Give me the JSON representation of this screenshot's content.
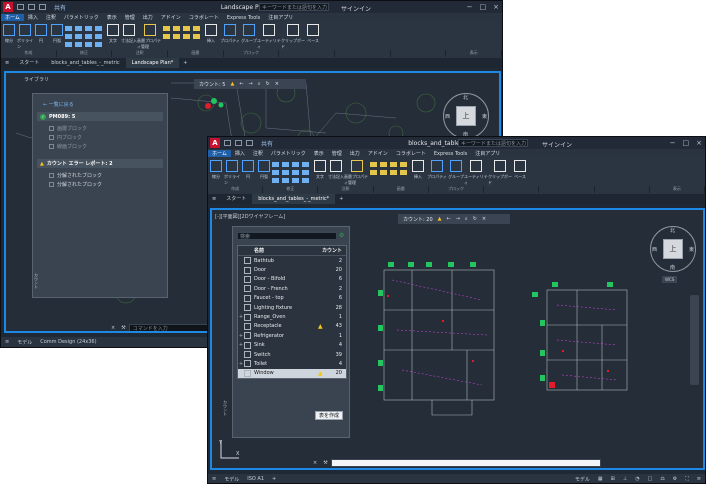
{
  "back_window": {
    "title": "Landscape Plan.dwg",
    "share": "共有",
    "search_placeholder": "キーワードまたは語句を入力",
    "signin": "サインイン",
    "menus": [
      "ホーム",
      "挿入",
      "注釈",
      "パラメトリック",
      "表示",
      "管理",
      "出力",
      "アドイン",
      "コラボレート",
      "Express Tools",
      "注目アプリ"
    ],
    "ribbon_tools": [
      "線分",
      "ポリライン",
      "円",
      "円弧"
    ],
    "ribbon_text": [
      "文字",
      "寸法記入"
    ],
    "ribbon_layers": "画層プロパティ管理",
    "ribbon_insert": "挿入",
    "ribbon_props": "プロパティ",
    "ribbon_group": "グループ",
    "ribbon_util": "ユーティリティ",
    "ribbon_clip": "クリップボード",
    "ribbon_base": "ベース",
    "panels": [
      "作成",
      "修正",
      "注釈",
      "画層",
      "ブロック",
      "",
      "",
      "",
      "表示"
    ],
    "tabs": [
      "スタート",
      "blocks_and_tables_-_metric",
      "Landscape Plan*"
    ],
    "canvas_label": "ライブラリ",
    "count_label": "カウント: 5",
    "palette": {
      "back_link": "← 一覧に戻る",
      "block_section": "PM089: 5",
      "items": [
        "画層ブロック",
        "円ブロック",
        "線画ブロック"
      ],
      "report_section": "カウント エラー レポート: 2",
      "errors": [
        "分解されたブロック",
        "分解されたブロック"
      ],
      "side_label": "カウント"
    },
    "cmd_placeholder": "コマンドを入力",
    "status_tabs": [
      "モデル",
      "Comm Design (24x36)"
    ],
    "compass": {
      "top": "北",
      "bottom": "南",
      "left": "西",
      "right": "東",
      "face": "上"
    }
  },
  "front_window": {
    "title": "blocks_and_tables_-_metric.dwg",
    "share": "共有",
    "search_placeholder": "キーワードまたは語句を入力",
    "signin": "サインイン",
    "menus": [
      "ホーム",
      "挿入",
      "注釈",
      "パラメトリック",
      "表示",
      "管理",
      "出力",
      "アドイン",
      "コラボレート",
      "Express Tools",
      "注目アプリ"
    ],
    "ribbon_tools": [
      "線分",
      "ポリライン",
      "円",
      "円弧"
    ],
    "ribbon_text": [
      "文字",
      "寸法記入"
    ],
    "ribbon_layers": "画層プロパティ管理",
    "ribbon_insert": "挿入",
    "ribbon_props": "プロパティ",
    "ribbon_group": "グループ",
    "ribbon_util": "ユーティリティ",
    "ribbon_clip": "クリップボード",
    "ribbon_base": "ベース",
    "panels": [
      "作成",
      "修正",
      "注釈",
      "画層",
      "ブロック",
      "",
      "",
      "",
      "表示"
    ],
    "tabs": [
      "スタート",
      "blocks_and_tables_-_metric*"
    ],
    "canvas_label": "[-][平面図][2Dワイヤフレーム]",
    "count_label": "カウント: 20",
    "compass": {
      "top": "北",
      "bottom": "南",
      "left": "西",
      "right": "東",
      "face": "上",
      "wcs": "WCS"
    },
    "table": {
      "search_placeholder": "検索",
      "col_name": "名前",
      "col_count": "カウント",
      "rows": [
        {
          "name": "Bathtub",
          "count": "2",
          "expand": "",
          "warn": false
        },
        {
          "name": "Door",
          "count": "20",
          "expand": "",
          "warn": false
        },
        {
          "name": "Door - Bifold",
          "count": "6",
          "expand": "",
          "warn": false
        },
        {
          "name": "Door - French",
          "count": "2",
          "expand": "",
          "warn": false
        },
        {
          "name": "Faucet - top",
          "count": "6",
          "expand": "",
          "warn": false
        },
        {
          "name": "Lighting fixture",
          "count": "28",
          "expand": "",
          "warn": false
        },
        {
          "name": "Range_Oven",
          "count": "1",
          "expand": "+",
          "warn": false
        },
        {
          "name": "Receptacle",
          "count": "43",
          "expand": "",
          "warn": true
        },
        {
          "name": "Refrigerator",
          "count": "1",
          "expand": "+",
          "warn": false
        },
        {
          "name": "Sink",
          "count": "4",
          "expand": "+",
          "warn": false
        },
        {
          "name": "Switch",
          "count": "39",
          "expand": "",
          "warn": false
        },
        {
          "name": "Toilet",
          "count": "4",
          "expand": "+",
          "warn": false
        },
        {
          "name": "Window",
          "count": "20",
          "expand": "",
          "warn": true
        }
      ],
      "button": "表を作成",
      "side_label": "カウント"
    },
    "status_tabs": [
      "モデル",
      "ISO A1"
    ],
    "status_right": [
      "モデル"
    ]
  },
  "colors": {
    "accent": "#1e88e5",
    "warning": "#f5c518",
    "ok": "#2ea44f",
    "logo": "#c8102e"
  }
}
